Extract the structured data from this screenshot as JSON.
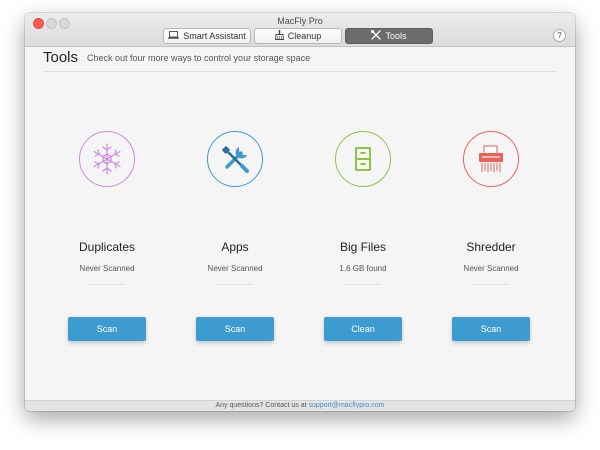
{
  "window": {
    "title": "MacFly Pro"
  },
  "tabs": [
    {
      "label": "Smart Assistant",
      "icon": "laptop-icon",
      "active": false
    },
    {
      "label": "Cleanup",
      "icon": "broom-icon",
      "active": false
    },
    {
      "label": "Tools",
      "icon": "tools-icon",
      "active": true
    }
  ],
  "help_label": "?",
  "page": {
    "heading": "Tools",
    "subheading": "Check out four more ways to control your storage space"
  },
  "tools": [
    {
      "name": "Duplicates",
      "status": "Never Scanned",
      "button": "Scan",
      "icon": "snowflake-icon",
      "color": "#cc8ae0"
    },
    {
      "name": "Apps",
      "status": "Never Scanned",
      "button": "Scan",
      "icon": "wrench-screwdriver-icon",
      "color": "#3d9bd2"
    },
    {
      "name": "Big Files",
      "status": "1.6 GB found",
      "button": "Clean",
      "icon": "file-cabinet-icon",
      "color": "#8fc24a"
    },
    {
      "name": "Shredder",
      "status": "Never Scanned",
      "button": "Scan",
      "icon": "shredder-icon",
      "color": "#e8625c"
    }
  ],
  "footer": {
    "text": "Any questions? Contact us at",
    "email": "support@macflypro.com"
  },
  "colors": {
    "accent": "#3d9bd2",
    "active_tab": "#6c6c6c"
  }
}
